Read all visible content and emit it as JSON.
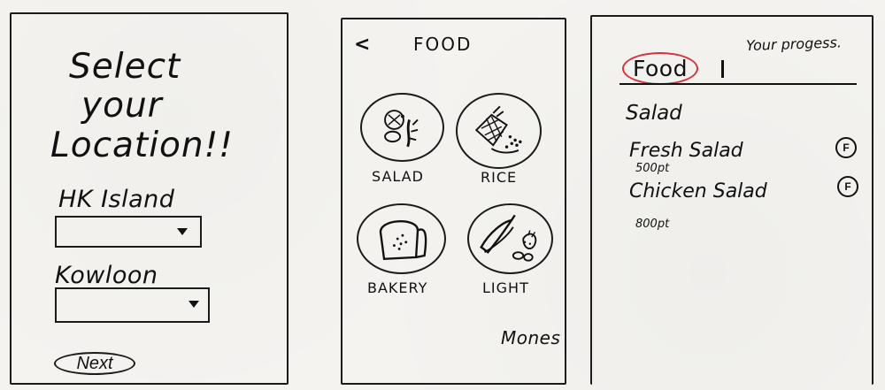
{
  "location_screen": {
    "title_lines": [
      "Select",
      "your",
      "Location!!"
    ],
    "regions": [
      {
        "label": "HK Island"
      },
      {
        "label": "Kowloon"
      }
    ],
    "next_label": "Next"
  },
  "food_screen": {
    "back_symbol": "<",
    "header": "FOOD",
    "categories": [
      {
        "label": "SALAD",
        "icon": "salad-icon"
      },
      {
        "label": "RICE",
        "icon": "rice-icon"
      },
      {
        "label": "BAKERY",
        "icon": "bread-icon"
      },
      {
        "label": "LIGHT",
        "icon": "fruit-icon"
      }
    ],
    "more_label": "Mones"
  },
  "menu_screen": {
    "tabs": [
      {
        "label": "Food",
        "selected": true
      },
      {
        "label": "Your progess."
      }
    ],
    "section_title": "Salad",
    "items": [
      {
        "name": "Fresh Salad",
        "price": "500pt",
        "action_icon": "f-icon",
        "action_symbol": "F"
      },
      {
        "name": "Chicken Salad",
        "price": "800pt",
        "action_icon": "f-icon",
        "action_symbol": "F"
      }
    ]
  },
  "colors": {
    "ink": "#161616",
    "paper": "#f3f2ef",
    "highlight": "#d9333a"
  }
}
